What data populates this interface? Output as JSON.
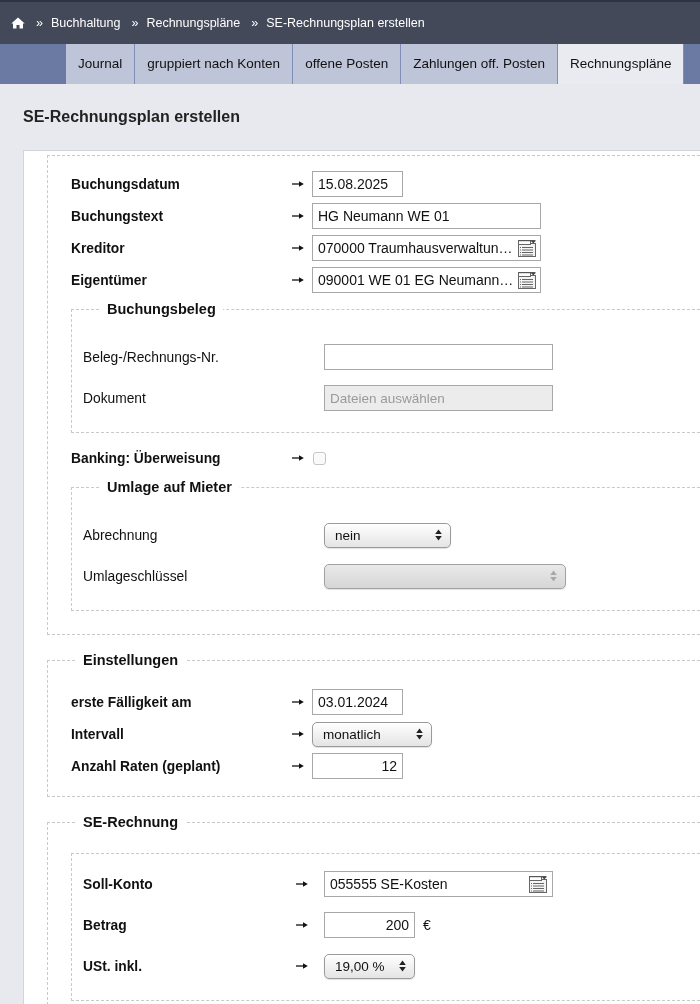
{
  "breadcrumb": {
    "items": [
      {
        "separator": "»",
        "label": "Buchhaltung"
      },
      {
        "separator": "»",
        "label": "Rechnungspläne"
      },
      {
        "separator": "»",
        "label": "SE-Rechnungsplan erstellen"
      }
    ]
  },
  "tabs": [
    {
      "label": "Journal",
      "selected": false
    },
    {
      "label": "gruppiert nach Konten",
      "selected": false
    },
    {
      "label": "offene Posten",
      "selected": false
    },
    {
      "label": "Zahlungen off. Posten",
      "selected": false
    },
    {
      "label": "Rechnungspläne",
      "selected": true
    }
  ],
  "page_title": "SE-Rechnungsplan erstellen",
  "sections": [
    {
      "items": [
        {
          "kind": "date",
          "label": "Buchungsdatum",
          "arrow": true,
          "value": "15.08.2025",
          "disabled": false
        },
        {
          "kind": "text",
          "label": "Buchungstext",
          "arrow": true,
          "value": "HG Neumann WE 01",
          "disabled": false
        },
        {
          "kind": "lookup",
          "label": "Kreditor",
          "arrow": true,
          "value": "070000 Traumhausverwaltun…",
          "disabled": false
        },
        {
          "kind": "lookup",
          "label": "Eigentümer",
          "arrow": true,
          "value": "090001 WE 01 EG Neumann…",
          "disabled": false
        },
        {
          "kind": "group",
          "legend": "Buchungsbeleg",
          "items": [
            {
              "kind": "text",
              "label": "Beleg-/Rechnungs-Nr.",
              "arrow": false,
              "disabled": false
            },
            {
              "kind": "file",
              "label": "Dokument",
              "arrow": false,
              "value": "Dateien auswählen",
              "disabled": true
            }
          ]
        },
        {
          "kind": "checkbox",
          "label": "Banking: Überweisung",
          "arrow": true,
          "checked": false,
          "disabled": false
        },
        {
          "kind": "group",
          "legend": "Umlage auf Mieter",
          "items": [
            {
              "kind": "select",
              "label": "Abrechnung",
              "arrow": false,
              "value": "nein",
              "disabled": false
            },
            {
              "kind": "select",
              "label": "Umlageschlüssel",
              "arrow": false,
              "disabled": true
            }
          ]
        }
      ]
    },
    {
      "legend": "Einstellungen",
      "items": [
        {
          "kind": "date",
          "label": "erste Fälligkeit am",
          "arrow": true,
          "value": "03.01.2024",
          "disabled": false
        },
        {
          "kind": "select",
          "label": "Intervall",
          "arrow": true,
          "value": "monatlich",
          "disabled": false
        },
        {
          "kind": "number",
          "label": "Anzahl Raten (geplant)",
          "arrow": true,
          "value": "12",
          "disabled": false
        }
      ]
    },
    {
      "legend": "SE-Rechnung",
      "items": [
        {
          "kind": "group",
          "items": [
            {
              "kind": "lookup",
              "label": "Soll-Konto",
              "arrow": true,
              "value": "055555 SE-Kosten",
              "disabled": false
            },
            {
              "kind": "number",
              "label": "Betrag",
              "arrow": true,
              "value": "200",
              "unit": "€",
              "disabled": false
            },
            {
              "kind": "select",
              "label": "USt. inkl.",
              "arrow": true,
              "value": "19,00 %",
              "disabled": false
            }
          ]
        }
      ]
    }
  ]
}
